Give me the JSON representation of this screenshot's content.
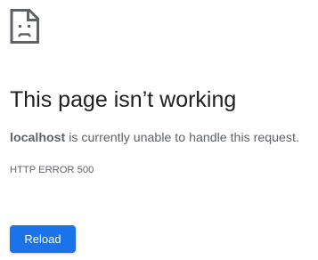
{
  "error_page": {
    "icon": "sad-page-icon",
    "title": "This page isn’t working",
    "message_host": "localhost",
    "message_text": " is currently unable to handle this request.",
    "error_code": "HTTP ERROR 500",
    "reload_label": "Reload"
  },
  "colors": {
    "accent": "#1a73e8",
    "title_text": "#202124",
    "body_text": "#5f6368",
    "background": "#ffffff"
  }
}
